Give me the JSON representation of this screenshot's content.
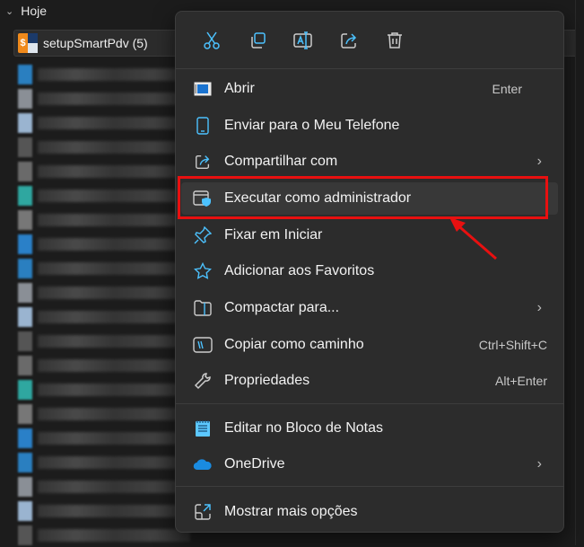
{
  "group": {
    "label": "Hoje"
  },
  "selected_file": {
    "name": "setupSmartPdv (5)"
  },
  "toolbar": [
    {
      "name": "cut-icon",
      "label": "Recortar"
    },
    {
      "name": "copy-icon",
      "label": "Copiar"
    },
    {
      "name": "rename-icon",
      "label": "Renomear"
    },
    {
      "name": "share-icon",
      "label": "Compartilhar"
    },
    {
      "name": "delete-icon",
      "label": "Excluir"
    }
  ],
  "menu": {
    "items": [
      {
        "label": "Abrir",
        "shortcut": "Enter"
      },
      {
        "label": "Enviar para o Meu Telefone"
      },
      {
        "label": "Compartilhar com"
      },
      {
        "label": "Executar como administrador"
      },
      {
        "label": "Fixar em Iniciar"
      },
      {
        "label": "Adicionar aos Favoritos"
      },
      {
        "label": "Compactar para..."
      },
      {
        "label": "Copiar como caminho",
        "shortcut": "Ctrl+Shift+C"
      },
      {
        "label": "Propriedades",
        "shortcut": "Alt+Enter"
      },
      {
        "label": "Editar no Bloco de Notas"
      },
      {
        "label": "OneDrive"
      },
      {
        "label": "Mostrar mais opções"
      }
    ]
  },
  "colors": {
    "accent": "#4cc2ff",
    "highlight": "#e81010",
    "menu_bg": "#2c2c2c"
  }
}
